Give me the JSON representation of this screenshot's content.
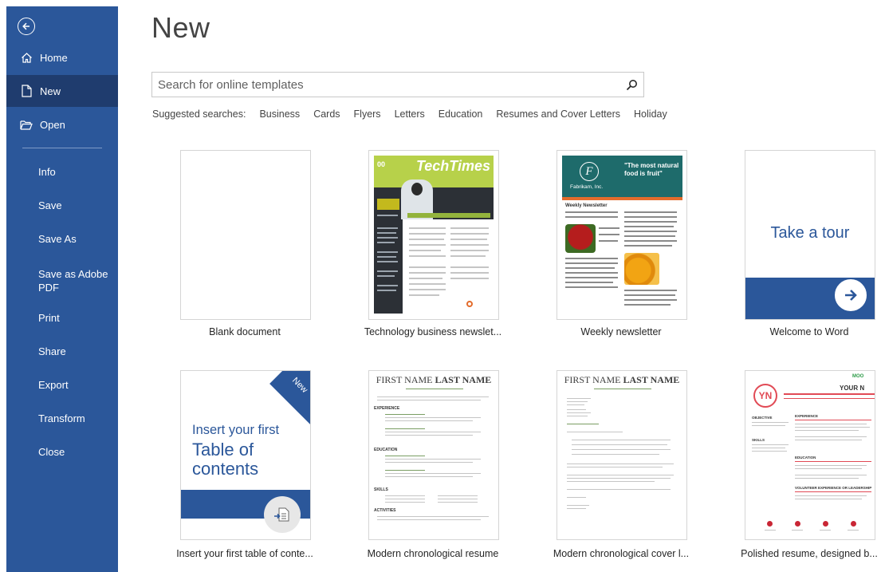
{
  "sidebar": {
    "items": [
      {
        "label": "Home"
      },
      {
        "label": "New"
      },
      {
        "label": "Open"
      },
      {
        "label": "Info"
      },
      {
        "label": "Save"
      },
      {
        "label": "Save As"
      },
      {
        "label": "Save as Adobe PDF"
      },
      {
        "label": "Print"
      },
      {
        "label": "Share"
      },
      {
        "label": "Export"
      },
      {
        "label": "Transform"
      },
      {
        "label": "Close"
      }
    ],
    "save_as_pdf_lines": [
      "Save as Adobe",
      "PDF"
    ],
    "accent": "#2b579a",
    "active_bg": "#1f3c6e"
  },
  "main": {
    "title": "New",
    "search": {
      "placeholder": "Search for online templates"
    },
    "suggested": {
      "label": "Suggested searches:",
      "items": [
        "Business",
        "Cards",
        "Flyers",
        "Letters",
        "Education",
        "Resumes and Cover Letters",
        "Holiday"
      ]
    },
    "templates": [
      {
        "caption": "Blank document"
      },
      {
        "caption": "Technology business newslet...",
        "thumb_title": "TechTimes",
        "thumb_issue": "00",
        "thumb_headline": "Exploring open source software opportunities"
      },
      {
        "caption": "Weekly newsletter",
        "thumb_quote": "\"The most natural food is fruit\"",
        "thumb_company": "Fabrikam, Inc.",
        "thumb_sub": "Weekly Newsletter",
        "thumb_logo": "F"
      },
      {
        "caption": "Welcome to Word",
        "thumb_text": "Take a tour"
      },
      {
        "caption": "Insert your first table of conte...",
        "thumb_line1": "Insert your first",
        "thumb_line2": "Table of contents",
        "thumb_badge": "New"
      },
      {
        "caption": "Modern chronological resume",
        "thumb_first": "FIRST NAME",
        "thumb_last": "LAST NAME",
        "thumb_sections": [
          "EXPERIENCE",
          "EDUCATION",
          "SKILLS",
          "ACTIVITIES"
        ]
      },
      {
        "caption": "Modern chronological cover l...",
        "thumb_first": "FIRST NAME",
        "thumb_last": "LAST NAME"
      },
      {
        "caption": "Polished resume, designed b...",
        "thumb_initials": "YN",
        "thumb_your": "YOUR N",
        "thumb_moo": "MOO",
        "thumb_sections": [
          "OBJECTIVE",
          "SKILLS",
          "EXPERIENCE",
          "EDUCATION",
          "VOLUNTEER EXPERIENCE OR LEADERSHIP"
        ]
      }
    ]
  }
}
